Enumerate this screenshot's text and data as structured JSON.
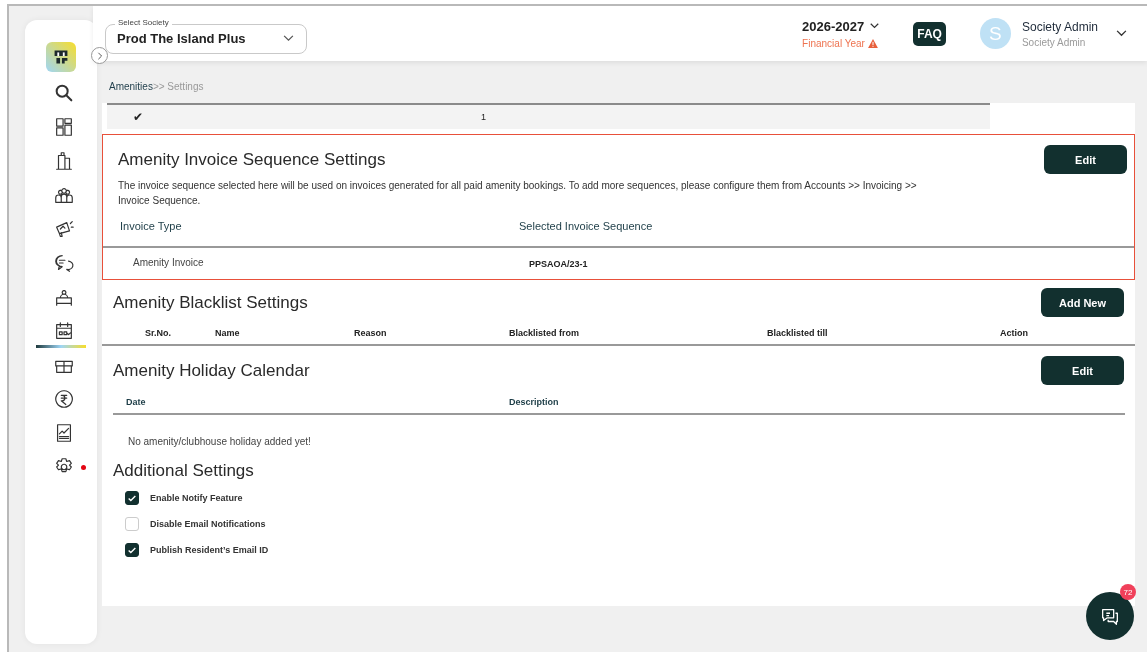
{
  "sidebar": {
    "items": [
      {
        "selected": false,
        "alert": false
      },
      {
        "selected": false,
        "alert": false
      },
      {
        "selected": false,
        "alert": false
      },
      {
        "selected": false,
        "alert": false
      },
      {
        "selected": false,
        "alert": false
      },
      {
        "selected": false,
        "alert": false
      },
      {
        "selected": false,
        "alert": false
      },
      {
        "selected": true,
        "alert": false
      },
      {
        "selected": false,
        "alert": false
      },
      {
        "selected": false,
        "alert": false
      },
      {
        "selected": false,
        "alert": false
      },
      {
        "selected": false,
        "alert": true
      }
    ]
  },
  "header": {
    "society_select": {
      "label": "Select Society",
      "value": "Prod The Island Plus"
    },
    "financial_year": {
      "value": "2026-2027",
      "label": "Financial Year",
      "warning": true
    },
    "faq": "FAQ",
    "user": {
      "initial": "S",
      "name": "Society Admin",
      "role": "Society Admin"
    }
  },
  "breadcrumb": {
    "parent": "Amenities",
    "separator": ">>",
    "current": "Settings"
  },
  "top_row": {
    "cells": [
      "✔",
      "1"
    ]
  },
  "invoice_section": {
    "title": "Amenity Invoice Sequence Settings",
    "button": "Edit",
    "highlighted": true,
    "description": "The invoice sequence selected here will be used on invoices generated for all paid amenity bookings. To add more sequences, please configure them from Accounts >> Invoicing >> Invoice Sequence.",
    "columns": [
      "Invoice Type",
      "Selected Invoice Sequence"
    ],
    "rows": [
      [
        "Amenity Invoice",
        "PPSAOA/23-1"
      ]
    ]
  },
  "blacklist_section": {
    "title": "Amenity Blacklist Settings",
    "button": "Add New",
    "columns": [
      "Sr.No.",
      "Name",
      "Reason",
      "Blacklisted from",
      "Blacklisted till",
      "Action"
    ]
  },
  "holiday_section": {
    "title": "Amenity Holiday Calendar",
    "button": "Edit",
    "columns": [
      "Date",
      "Description"
    ],
    "empty_message": "No amenity/clubhouse holiday added yet!"
  },
  "additional_settings": {
    "title": "Additional Settings",
    "options": [
      {
        "label": "Enable Notify Feature",
        "checked": true
      },
      {
        "label": "Disable Email Notifications",
        "checked": false
      },
      {
        "label": "Publish Resident’s Email ID",
        "checked": true
      }
    ]
  },
  "chat_button": {
    "badge": "72"
  }
}
